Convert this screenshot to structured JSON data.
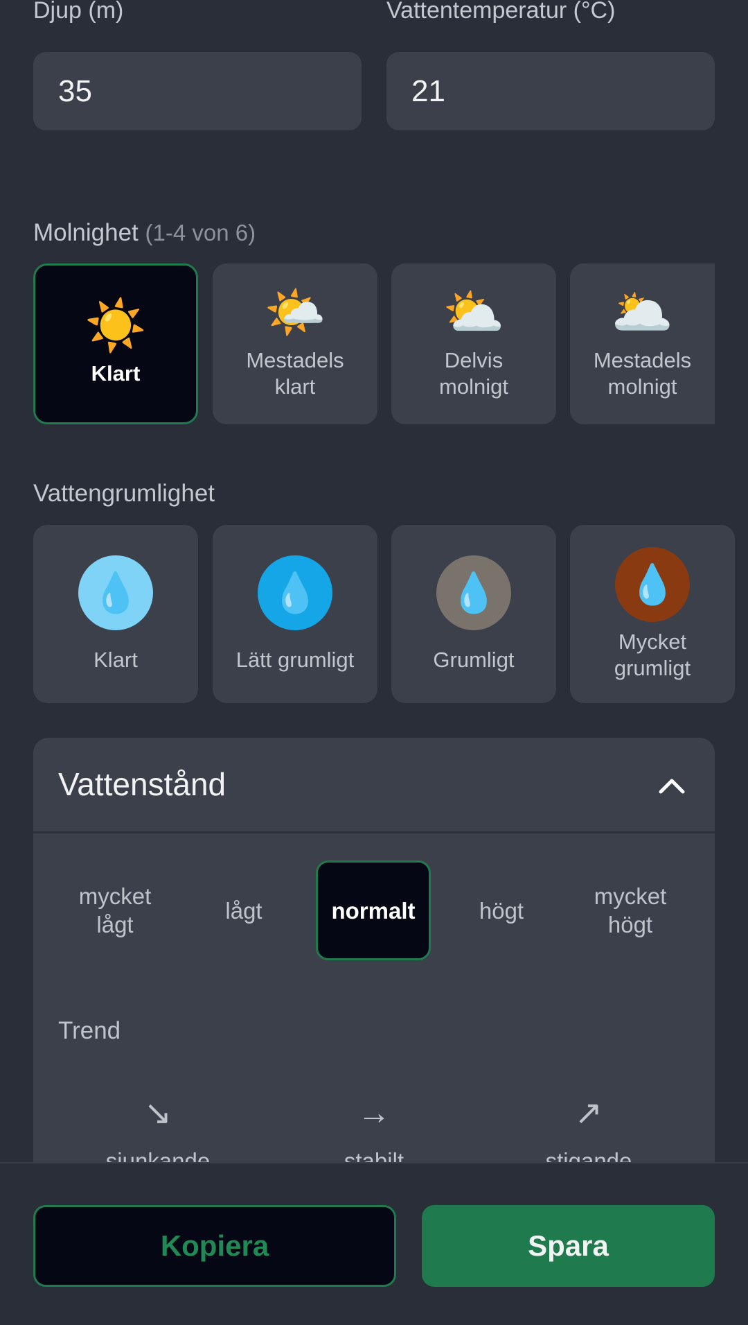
{
  "fields": {
    "depth_label": "Djup (m)",
    "depth_value": "35",
    "temp_label": "Vattentemperatur (°C)",
    "temp_value": "21"
  },
  "cloudiness": {
    "label": "Molnighet",
    "range_hint": "(1-4 von 6)",
    "options": [
      {
        "icon": "sun-icon",
        "emoji": "☀️",
        "label": "Klart",
        "selected": true
      },
      {
        "icon": "sun-behind-small-cloud-icon",
        "emoji": "🌤️",
        "label": "Mestadels klart",
        "selected": false
      },
      {
        "icon": "sun-behind-cloud-icon",
        "emoji": "⛅",
        "label": "Delvis molnigt",
        "selected": false
      },
      {
        "icon": "sun-behind-large-cloud-icon",
        "emoji": "🌥️",
        "label": "Mestadels molnigt",
        "selected": false
      }
    ]
  },
  "turbidity": {
    "label": "Vattengrumlighet",
    "options": [
      {
        "icon": "droplet-icon",
        "emoji": "💧",
        "label": "Klart",
        "color": "#7fd3f7"
      },
      {
        "icon": "droplet-icon",
        "emoji": "💧",
        "label": "Lätt grumligt",
        "color": "#14a6e6"
      },
      {
        "icon": "droplet-icon",
        "emoji": "💧",
        "label": "Grumligt",
        "color": "#7a736b"
      },
      {
        "icon": "droplet-icon",
        "emoji": "💧",
        "label": "Mycket grumligt",
        "color": "#8a3a10"
      }
    ]
  },
  "water_level": {
    "title": "Vattenstånd",
    "expanded": true,
    "options": [
      {
        "label": "mycket lågt",
        "selected": false
      },
      {
        "label": "lågt",
        "selected": false
      },
      {
        "label": "normalt",
        "selected": true
      },
      {
        "label": "högt",
        "selected": false
      },
      {
        "label": "mycket högt",
        "selected": false
      }
    ],
    "trend_label": "Trend",
    "trend_options": [
      {
        "arrow": "↘",
        "label": "sjunkande"
      },
      {
        "arrow": "→",
        "label": "stabilt"
      },
      {
        "arrow": "↗",
        "label": "stigande"
      }
    ]
  },
  "actions": {
    "copy_label": "Kopiera",
    "save_label": "Spara"
  },
  "colors": {
    "accent": "#1f7a4d",
    "background": "#2a2e38",
    "card": "#3c404b"
  }
}
